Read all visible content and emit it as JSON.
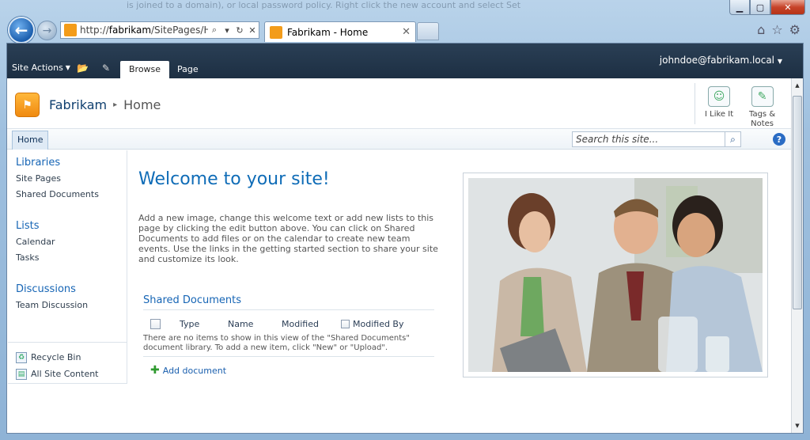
{
  "browser": {
    "background_text": "is joined to a domain), or local password policy. Right click the new account and select Set",
    "address_prefix": "http://",
    "address_host": "fabrikam",
    "address_path": "/SitePages/Hor",
    "tab_title": "Fabrikam - Home",
    "controls": {
      "minimize": "▁",
      "maximize": "▢",
      "close": "✕"
    }
  },
  "ribbon": {
    "site_actions": "Site Actions",
    "tabs": [
      "Browse",
      "Page"
    ],
    "user": "johndoe@fabrikam.local"
  },
  "title_area": {
    "site_name": "Fabrikam",
    "current_page": "Home",
    "i_like_it": "I Like It",
    "tags_notes_1": "Tags &",
    "tags_notes_2": "Notes"
  },
  "top_nav": {
    "home": "Home",
    "search_placeholder": "Search this site..."
  },
  "quick_launch": {
    "sections": [
      {
        "heading": "Libraries",
        "items": [
          "Site Pages",
          "Shared Documents"
        ]
      },
      {
        "heading": "Lists",
        "items": [
          "Calendar",
          "Tasks"
        ]
      },
      {
        "heading": "Discussions",
        "items": [
          "Team Discussion"
        ]
      }
    ],
    "recycle_bin": "Recycle Bin",
    "all_site_content": "All Site Content"
  },
  "main": {
    "welcome": "Welcome to your site!",
    "intro": "Add a new image, change this welcome text or add new lists to this page by clicking the edit button above. You can click on Shared Documents to add files or on the calendar to create new team events. Use the links in the getting started section to share your site and customize its look.",
    "library": {
      "title": "Shared Documents",
      "columns": [
        "Type",
        "Name",
        "Modified",
        "Modified By"
      ],
      "empty_text": "There are no items to show in this view of the \"Shared Documents\" document library. To add a new item, click \"New\" or \"Upload\".",
      "add_document": "Add document"
    }
  },
  "colors": {
    "ribbon_bg": "#1d2f43",
    "link_blue": "#1665b5",
    "logo_orange": "#f39c1a"
  }
}
